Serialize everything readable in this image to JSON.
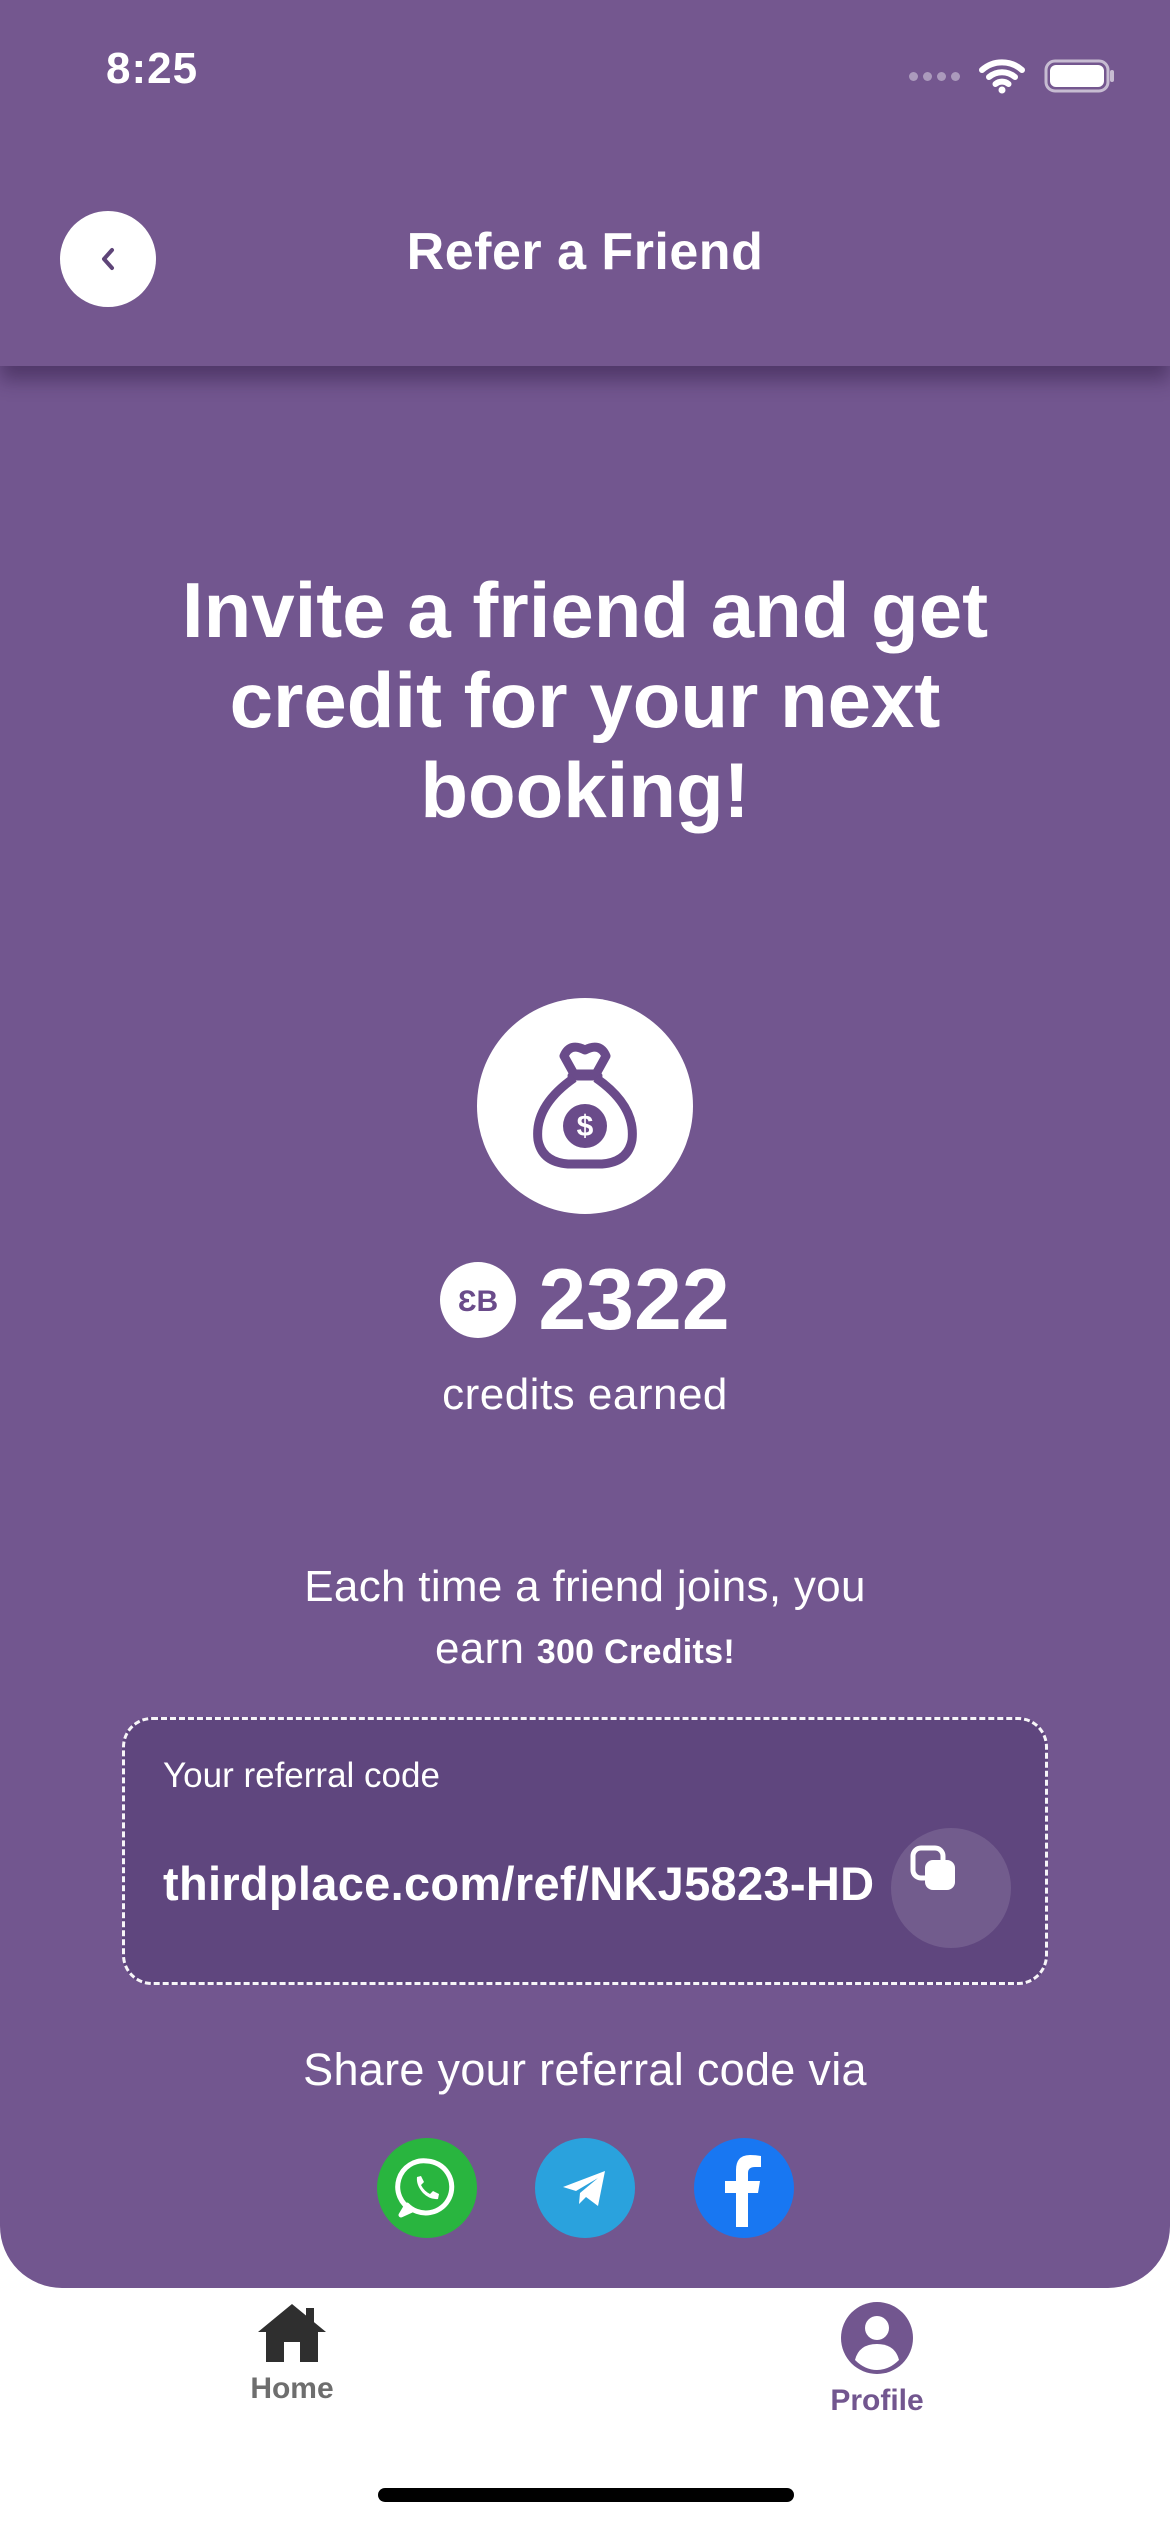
{
  "status_bar": {
    "time": "8:25"
  },
  "header": {
    "title": "Refer a Friend"
  },
  "headline": "Invite a friend and get credit for your next booking!",
  "credits": {
    "value": "2322",
    "label": "credits earned"
  },
  "info": {
    "line1": "Each time a friend joins, you",
    "line2_prefix": "earn ",
    "line2_bold": "300 Credits!"
  },
  "referral": {
    "label": "Your referral code",
    "code": "thirdplace.com/ref/NKJ5823-HD"
  },
  "share": {
    "label": "Share your referral code via"
  },
  "tabs": [
    {
      "label": "Home",
      "icon": "home-icon"
    },
    {
      "label": "Profile",
      "icon": "profile-icon"
    }
  ],
  "colors": {
    "primary_purple": "#72568f",
    "box_purple": "#5f467e",
    "whatsapp": "#29b53f",
    "telegram": "#2aa2dd",
    "facebook": "#1877f2",
    "tab_inactive": "#6e6e6e",
    "tab_active": "#72568f"
  }
}
